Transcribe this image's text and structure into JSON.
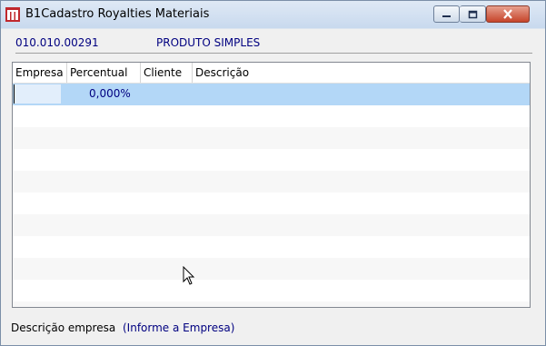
{
  "window": {
    "title": "B1Cadastro Royalties Materiais",
    "controls": {
      "minimize_icon": "minimize-icon",
      "maximize_icon": "maximize-icon",
      "close_icon": "close-icon"
    }
  },
  "header": {
    "code": "010.010.00291",
    "product": "PRODUTO SIMPLES"
  },
  "grid": {
    "columns": [
      "Empresa",
      "Percentual",
      "Cliente",
      "Descrição"
    ],
    "rows": [
      {
        "empresa": "",
        "percentual": "0,000%",
        "cliente": "",
        "descricao": ""
      }
    ]
  },
  "footer": {
    "label": "Descrição empresa",
    "value": "(Informe a Empresa)"
  },
  "colors": {
    "accent_text": "#000080",
    "selected_row": "#b3d7f7"
  }
}
